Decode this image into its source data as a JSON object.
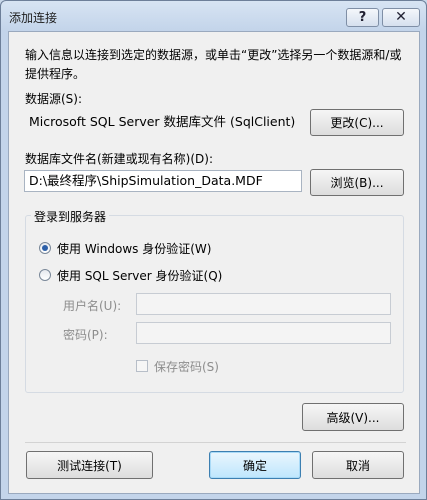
{
  "window": {
    "title": "添加连接",
    "help_label": "?",
    "close_label": "✕"
  },
  "description": "输入信息以连接到选定的数据源，或单击“更改”选择另一个数据源和/或提供程序。",
  "datasource": {
    "label": "数据源(S):",
    "value": "Microsoft SQL Server 数据库文件 (SqlClient)",
    "change_button": "更改(C)..."
  },
  "dbfile": {
    "label": "数据库文件名(新建或现有名称)(D):",
    "value": "D:\\最终程序\\ShipSimulation_Data.MDF",
    "browse_button": "浏览(B)..."
  },
  "login": {
    "group_title": "登录到服务器",
    "windows_auth": "使用 Windows 身份验证(W)",
    "sql_auth": "使用 SQL Server 身份验证(Q)",
    "selected": "windows",
    "username_label": "用户名(U):",
    "username_value": "",
    "password_label": "密码(P):",
    "password_value": "",
    "save_password": "保存密码(S)"
  },
  "buttons": {
    "advanced": "高级(V)...",
    "test": "测试连接(T)",
    "ok": "确定",
    "cancel": "取消"
  }
}
